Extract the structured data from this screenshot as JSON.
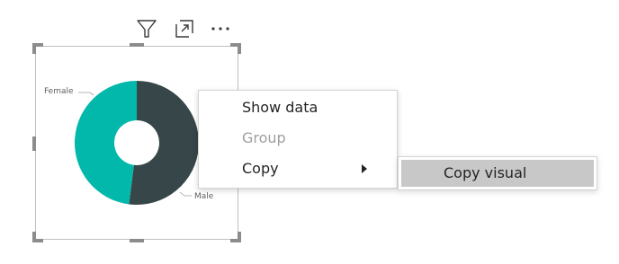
{
  "visual": {
    "legend": {
      "female_label": "Female",
      "male_label": "Male"
    },
    "colors": {
      "female": "#01B8AA",
      "male": "#374649",
      "handles": "#8C8C8C",
      "frame_border": "#BFBFBF"
    },
    "header_icons": [
      "filter-icon",
      "focus-mode-icon",
      "more-options-icon"
    ]
  },
  "chart_data": {
    "type": "pie",
    "variant": "donut",
    "categories": [
      "Female",
      "Male"
    ],
    "values": [
      48,
      52
    ],
    "colors": [
      "#01B8AA",
      "#374649"
    ]
  },
  "context_menu": {
    "items": [
      {
        "label": "Show data",
        "enabled": true
      },
      {
        "label": "Group",
        "enabled": false
      },
      {
        "label": "Copy",
        "enabled": true,
        "has_submenu": true
      }
    ],
    "submenu": {
      "items": [
        {
          "label": "Copy visual",
          "highlighted": true
        }
      ]
    }
  }
}
